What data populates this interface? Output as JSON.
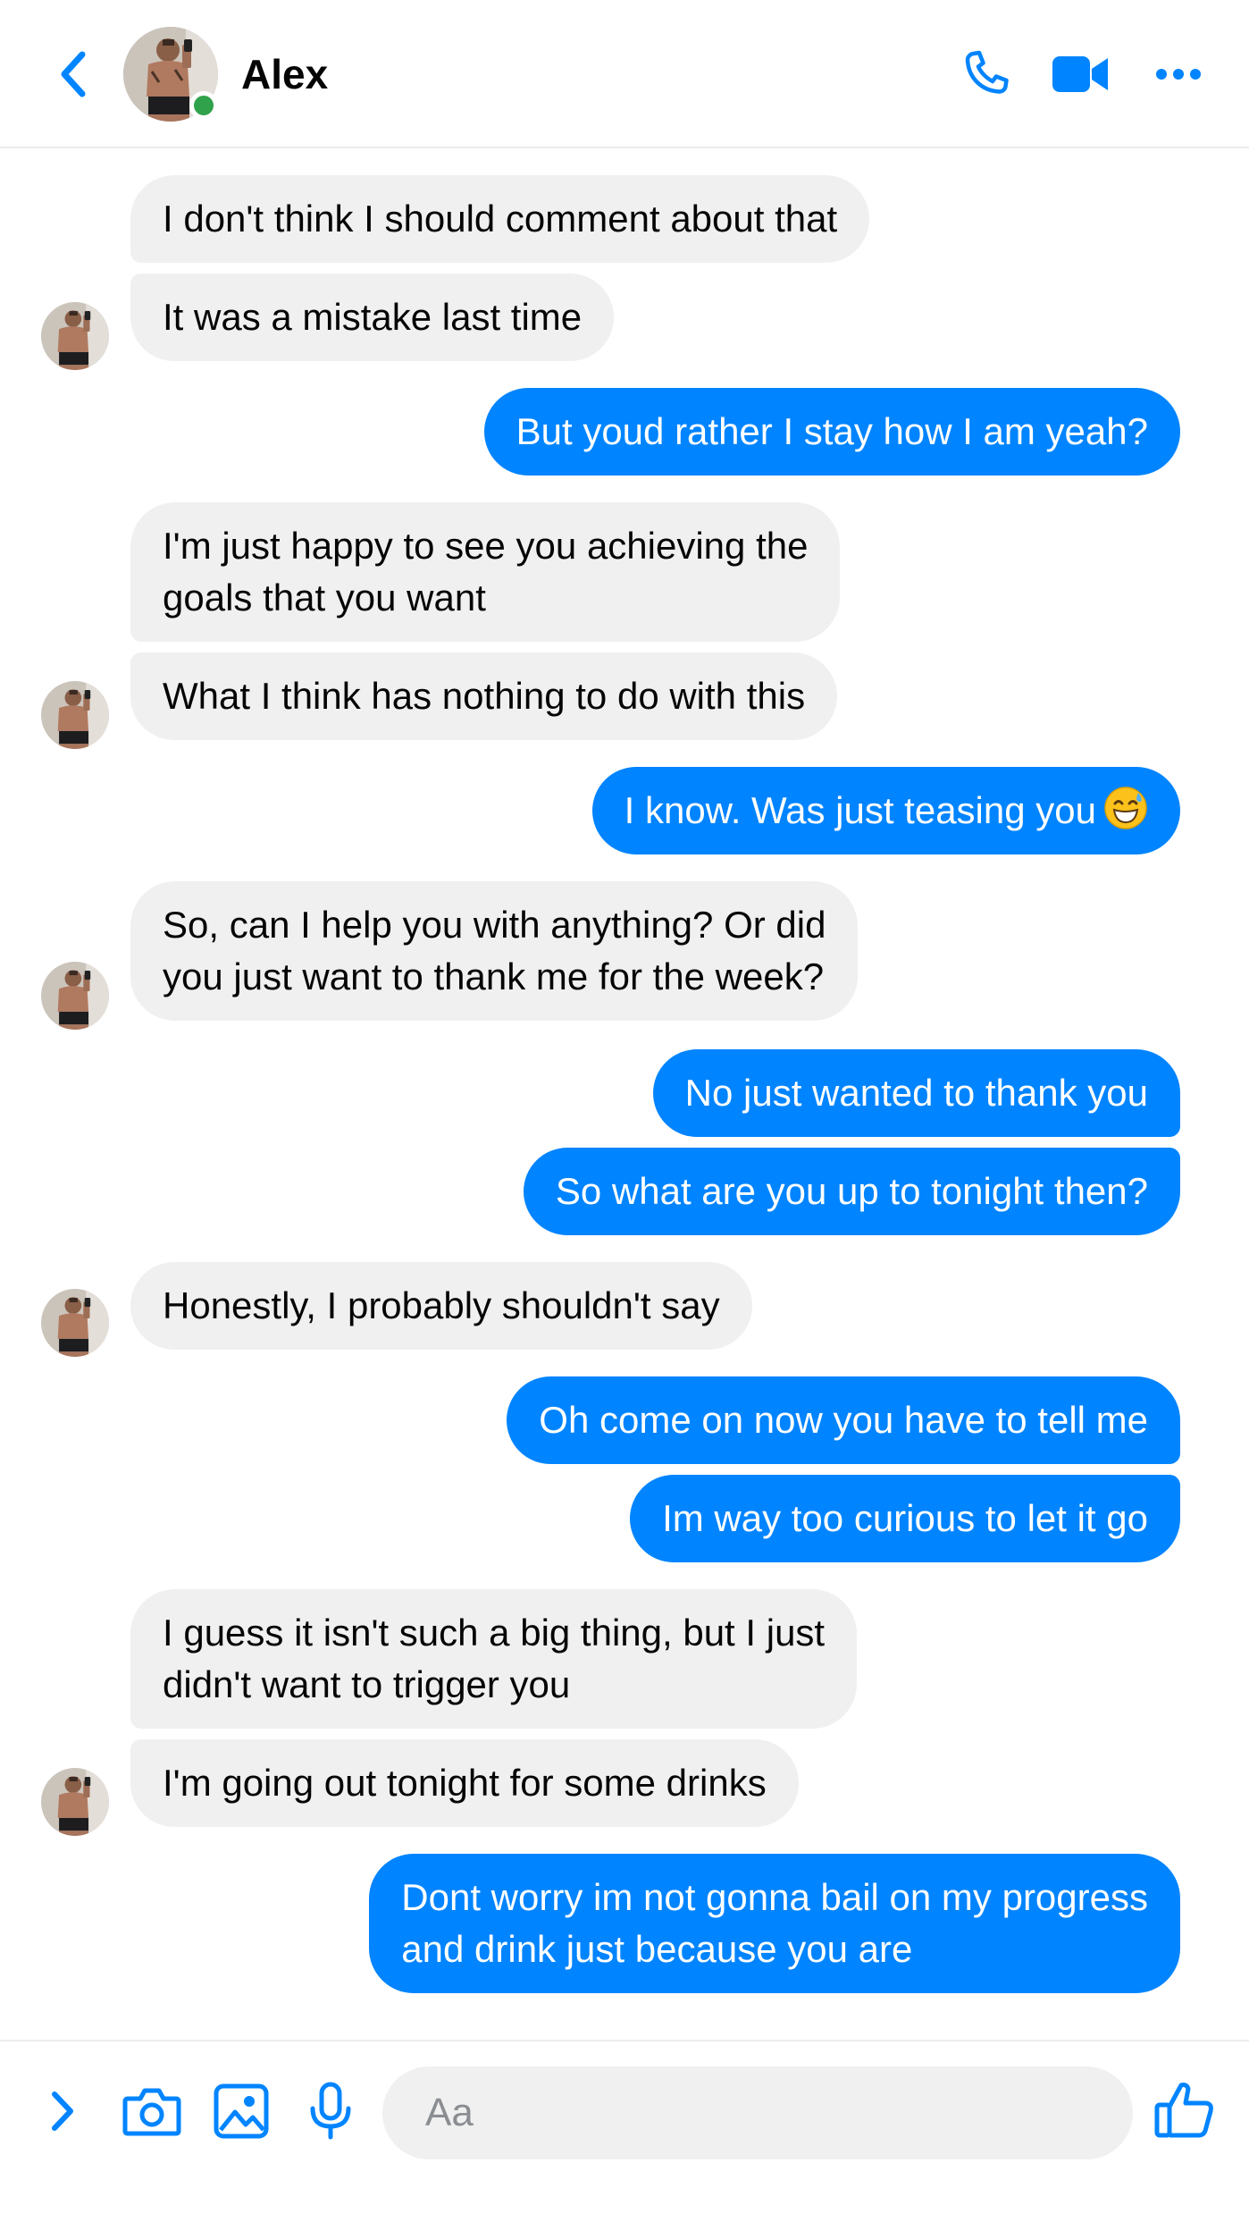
{
  "contact": {
    "name": "Alex",
    "status": "online"
  },
  "colors": {
    "accent": "#0084ff",
    "incoming_bubble": "#f0f0f0",
    "online": "#31a24c"
  },
  "icons": {
    "back": "chevron-left-icon",
    "call": "phone-icon",
    "video": "video-camera-icon",
    "more": "more-horizontal-icon",
    "expand": "chevron-right-icon",
    "camera": "camera-icon",
    "gallery": "image-icon",
    "mic": "microphone-icon",
    "like": "thumbs-up-icon"
  },
  "messages": [
    {
      "from": "contact",
      "lines": [
        "I don't think I should comment about that"
      ]
    },
    {
      "from": "contact",
      "lines": [
        "It was a mistake last time"
      ]
    },
    {
      "from": "me",
      "lines": [
        "But youd rather I stay how I am yeah?"
      ]
    },
    {
      "from": "contact",
      "lines": [
        "I'm just happy to see you achieving the",
        "goals that you want"
      ]
    },
    {
      "from": "contact",
      "lines": [
        "What I think has nothing to do with this"
      ]
    },
    {
      "from": "me",
      "lines": [
        "I know. Was just teasing you"
      ],
      "emoji": "grinning-face-with-sweat"
    },
    {
      "from": "contact",
      "lines": [
        "So, can I help you with anything? Or did",
        "you just want to thank me for the week?"
      ]
    },
    {
      "from": "me",
      "lines": [
        "No just wanted to thank you"
      ]
    },
    {
      "from": "me",
      "lines": [
        "So what are you up to tonight then?"
      ]
    },
    {
      "from": "contact",
      "lines": [
        "Honestly, I probably shouldn't say"
      ]
    },
    {
      "from": "me",
      "lines": [
        "Oh come on now you have to tell me"
      ]
    },
    {
      "from": "me",
      "lines": [
        "Im way too curious to let it go"
      ]
    },
    {
      "from": "contact",
      "lines": [
        "I guess it isn't such a big thing, but I just",
        "didn't want to trigger you"
      ]
    },
    {
      "from": "contact",
      "lines": [
        "I'm going out tonight for some drinks"
      ]
    },
    {
      "from": "me",
      "lines": [
        "Dont worry im not gonna bail on my progress",
        "and drink just because you are"
      ]
    }
  ],
  "composer": {
    "placeholder": "Aa",
    "value": ""
  }
}
